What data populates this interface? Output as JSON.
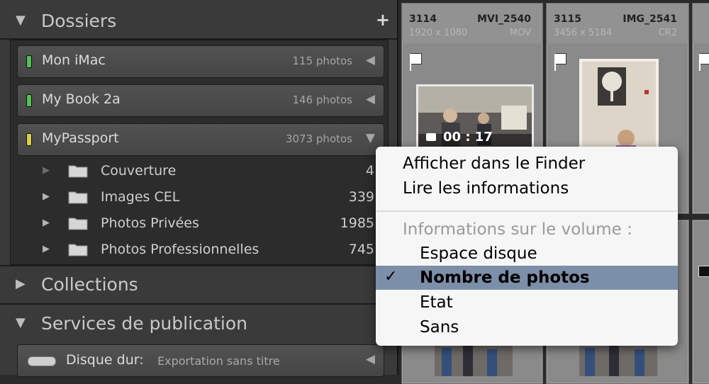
{
  "left_panel": {
    "dossiers": {
      "title": "Dossiers",
      "add_symbol": "+"
    },
    "volumes": [
      {
        "name": "Mon iMac",
        "count": "115 photos",
        "led_color": "#4fc34f",
        "arrow": "◀"
      },
      {
        "name": "My Book 2a",
        "count": "146 photos",
        "led_color": "#4fc34f",
        "arrow": "◀"
      },
      {
        "name": "MyPassport",
        "count": "3073 photos",
        "led_color": "#d8d040",
        "arrow": "▼"
      }
    ],
    "folders": [
      {
        "name": "Couverture",
        "count": "4"
      },
      {
        "name": "Images CEL",
        "count": "339"
      },
      {
        "name": "Photos Privées",
        "count": "1985"
      },
      {
        "name": "Photos Professionnelles",
        "count": "745"
      }
    ],
    "collections": {
      "title": "Collections",
      "add_symbol": "+"
    },
    "services": {
      "title": "Services de publication",
      "add_symbol": "+",
      "row": {
        "label": "Disque dur",
        "value": "Exportation sans titre",
        "arrow": "◀"
      }
    }
  },
  "grid": {
    "cells": [
      {
        "number": "3114",
        "filename": "MVI_2540",
        "dimensions": "1920 x 1080",
        "ext": "MOV",
        "video_duration": "00 : 17"
      },
      {
        "number": "3115",
        "filename": "IMG_2541",
        "dimensions": "3456 x 5184",
        "ext": "CR2"
      }
    ]
  },
  "context_menu": {
    "items": [
      {
        "label": "Afficher dans le Finder"
      },
      {
        "label": "Lire les informations"
      }
    ],
    "heading": "Informations sur le volume :",
    "options": [
      {
        "label": "Espace disque",
        "checked": false
      },
      {
        "label": "Nombre de photos",
        "checked": true
      },
      {
        "label": "Etat",
        "checked": false
      },
      {
        "label": "Sans",
        "checked": false
      }
    ],
    "check_symbol": "✓",
    "selected_color": "#7c8fa8"
  }
}
